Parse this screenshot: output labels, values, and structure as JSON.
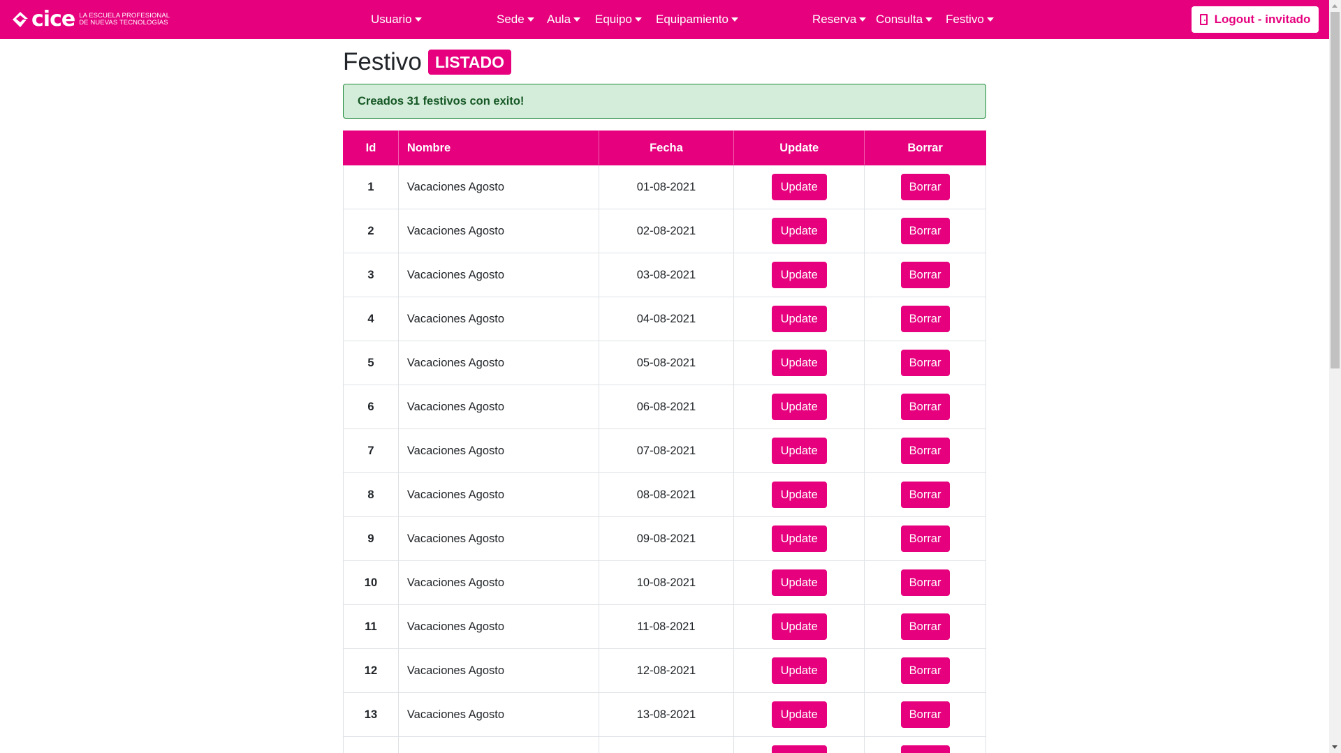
{
  "brand": {
    "name": "cice",
    "tagline_line1": "La escuela profesional",
    "tagline_line2": "de nuevas tecnologías"
  },
  "nav": {
    "items": [
      {
        "label": "Usuario"
      },
      {
        "label": "Sede"
      },
      {
        "label": "Aula"
      },
      {
        "label": "Equipo"
      },
      {
        "label": "Equipamiento"
      },
      {
        "label": "Reserva"
      },
      {
        "label": "Consulta"
      },
      {
        "label": "Festivo"
      }
    ],
    "logout_label": "Logout - invitado"
  },
  "page": {
    "title": "Festivo",
    "badge": "LISTADO",
    "alert": "Creados 31 festivos con exito!"
  },
  "table": {
    "headers": {
      "id": "Id",
      "name": "Nombre",
      "date": "Fecha",
      "update": "Update",
      "delete": "Borrar"
    },
    "update_label": "Update",
    "delete_label": "Borrar",
    "rows": [
      {
        "id": "1",
        "name": "Vacaciones Agosto",
        "date": "01-08-2021"
      },
      {
        "id": "2",
        "name": "Vacaciones Agosto",
        "date": "02-08-2021"
      },
      {
        "id": "3",
        "name": "Vacaciones Agosto",
        "date": "03-08-2021"
      },
      {
        "id": "4",
        "name": "Vacaciones Agosto",
        "date": "04-08-2021"
      },
      {
        "id": "5",
        "name": "Vacaciones Agosto",
        "date": "05-08-2021"
      },
      {
        "id": "6",
        "name": "Vacaciones Agosto",
        "date": "06-08-2021"
      },
      {
        "id": "7",
        "name": "Vacaciones Agosto",
        "date": "07-08-2021"
      },
      {
        "id": "8",
        "name": "Vacaciones Agosto",
        "date": "08-08-2021"
      },
      {
        "id": "9",
        "name": "Vacaciones Agosto",
        "date": "09-08-2021"
      },
      {
        "id": "10",
        "name": "Vacaciones Agosto",
        "date": "10-08-2021"
      },
      {
        "id": "11",
        "name": "Vacaciones Agosto",
        "date": "11-08-2021"
      },
      {
        "id": "12",
        "name": "Vacaciones Agosto",
        "date": "12-08-2021"
      },
      {
        "id": "13",
        "name": "Vacaciones Agosto",
        "date": "13-08-2021"
      },
      {
        "id": "",
        "name": "",
        "date": ""
      }
    ]
  },
  "colors": {
    "brand": "#e6007e",
    "alert_bg": "#d4edda",
    "alert_text": "#155724"
  }
}
